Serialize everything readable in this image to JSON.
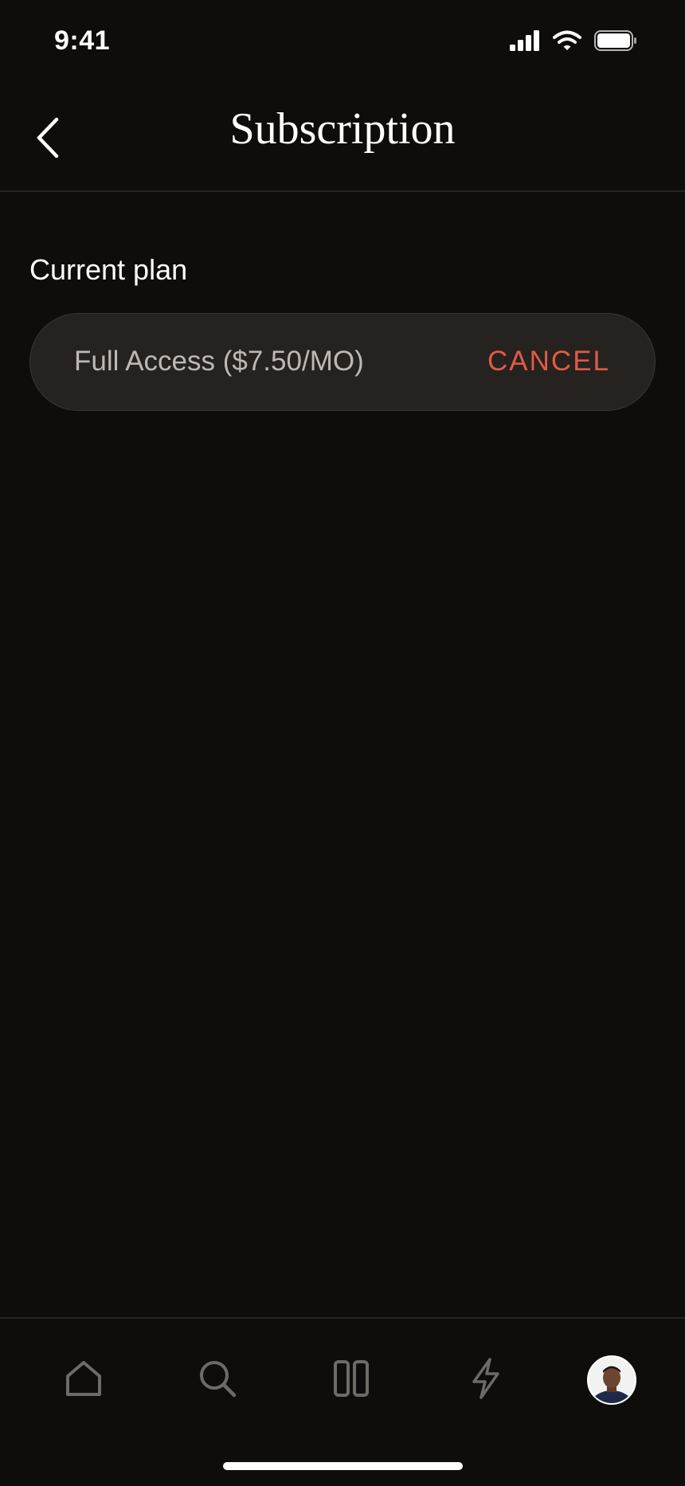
{
  "status_bar": {
    "time": "9:41",
    "icons": [
      "signal-icon",
      "wifi-icon",
      "battery-icon"
    ]
  },
  "header": {
    "title": "Subscription",
    "back_icon": "chevron-left-icon"
  },
  "current_plan": {
    "label": "Current plan",
    "plan_name": "Full Access ($7.50/MO)",
    "cancel_label": "CANCEL"
  },
  "tab_bar": {
    "tabs": [
      {
        "icon": "home-icon"
      },
      {
        "icon": "search-icon"
      },
      {
        "icon": "library-icon"
      },
      {
        "icon": "lightning-icon"
      },
      {
        "icon": "profile-avatar"
      }
    ]
  },
  "colors": {
    "background": "#0e0d0c",
    "card": "#252220",
    "accent_cancel": "#df5b45",
    "text_muted": "#bdb8b4",
    "icon_muted": "#6f6a66"
  }
}
